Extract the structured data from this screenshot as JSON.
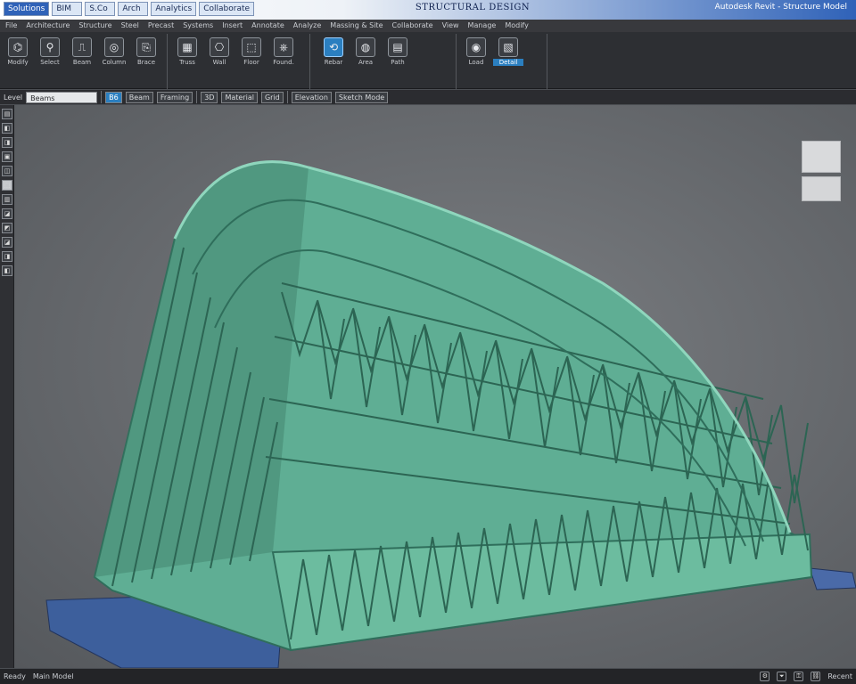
{
  "titlebar": {
    "tabs": [
      "Solutions",
      "BIM",
      "S.Co",
      "Arch",
      "Analytics",
      "Collaborate"
    ],
    "title": "STRUCTURAL DESIGN",
    "right_text": "Autodesk Revit - Structure Model"
  },
  "ribbon": {
    "tabs": [
      "File",
      "Architecture",
      "Structure",
      "Steel",
      "Precast",
      "Systems",
      "Insert",
      "Annotate",
      "Analyze",
      "Massing & Site",
      "Collaborate",
      "View",
      "Manage",
      "Modify"
    ],
    "groups": [
      {
        "buttons": [
          {
            "icon": "⌬",
            "label": "Modify"
          },
          {
            "icon": "⚲",
            "label": "Select"
          },
          {
            "icon": "⎍",
            "label": "Beam"
          },
          {
            "icon": "◎",
            "label": "Column"
          },
          {
            "icon": "⎘",
            "label": "Brace"
          }
        ]
      },
      {
        "buttons": [
          {
            "icon": "▦",
            "label": "Truss"
          },
          {
            "icon": "⎔",
            "label": "Wall"
          },
          {
            "icon": "⬚",
            "label": "Floor"
          },
          {
            "icon": "⎈",
            "label": "Found."
          }
        ]
      },
      {
        "buttons": [
          {
            "icon": "⟲",
            "label": "Rebar"
          },
          {
            "icon": "◍",
            "label": "Area"
          },
          {
            "icon": "▤",
            "label": "Path"
          }
        ]
      },
      {
        "buttons": [
          {
            "icon": "◉",
            "label": "Load"
          },
          {
            "icon": "▧",
            "label": "Detail"
          }
        ]
      }
    ]
  },
  "options_bar": {
    "mode_label": "Level",
    "field_value": "Beams",
    "items": [
      "B6",
      "Beam",
      "Framing",
      "3D",
      "Material",
      "Grid"
    ],
    "right_items": [
      "Elevation",
      "Sketch Mode"
    ]
  },
  "left_strip": {
    "items": [
      "▤",
      "◧",
      "◨",
      "▣",
      "◫",
      "⬚",
      "▥",
      "◪",
      "◩",
      "◪",
      "◨",
      "◧"
    ]
  },
  "viewport": {
    "model_color": "#5fae94",
    "model_line_color": "#2f6e5b",
    "base_color": "#3c5e9b"
  },
  "status": {
    "left_items": [
      "Ready",
      "Main Model"
    ],
    "right_items": [
      "Recent"
    ]
  }
}
